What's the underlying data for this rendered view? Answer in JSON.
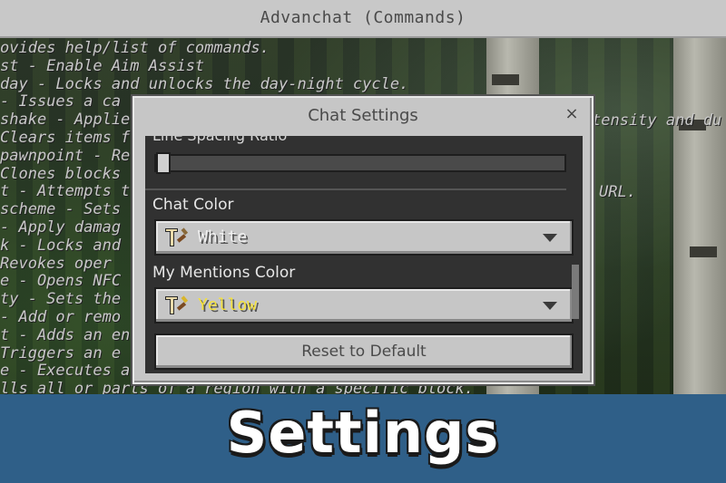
{
  "window": {
    "title": "Advanchat (Commands)"
  },
  "background": {
    "command_lines": [
      "ovides help/list of commands.",
      "st - Enable Aim Assist",
      "day - Locks and unlocks the day-night cycle.",
      " - Issues a ca",
      "shake - Applie",
      " Clears items f",
      "pawnpoint - Re",
      " Clones blocks",
      "t - Attempts to",
      "scheme - Sets",
      " - Apply damag",
      "k - Locks and u",
      " Revokes oper",
      "e - Opens NFC",
      "ty - Sets the c",
      " - Add or remo",
      "t - Adds an en",
      " Triggers an e",
      "e - Executes a",
      "lls all or parts of a region with a specific block."
    ],
    "right_fragments": [
      "tensity and du",
      "URL."
    ]
  },
  "dialog": {
    "title": "Chat Settings",
    "close_glyph": "×",
    "cut_label": "Line Spacing Ratio",
    "slider_value": 0.0,
    "chat_color": {
      "label": "Chat Color",
      "value": "White",
      "color": "#f0f0f0",
      "icon": "text-color-icon"
    },
    "mentions_color": {
      "label": "My Mentions Color",
      "value": "Yellow",
      "color": "#f5e23a",
      "icon": "text-color-icon"
    },
    "reset_label": "Reset to Default"
  },
  "banner": {
    "text": "Settings",
    "color": "#2f5f88"
  }
}
